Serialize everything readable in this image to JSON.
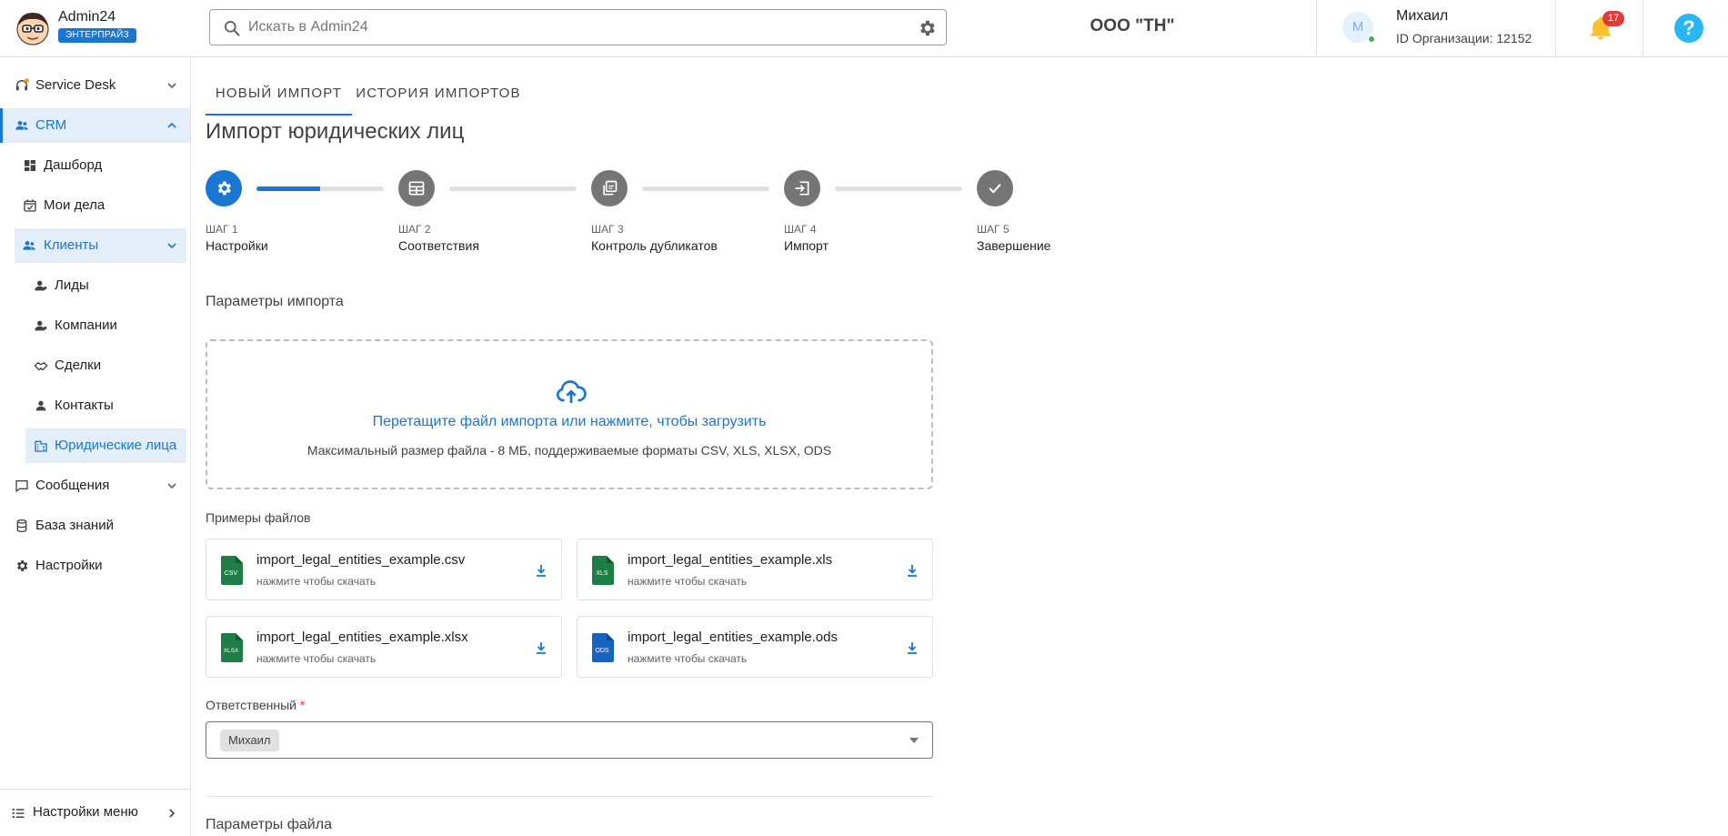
{
  "brand": {
    "name": "Admin24",
    "badge": "ЭНТЕРПРАЙЗ"
  },
  "search": {
    "placeholder": "Искать в Admin24"
  },
  "organization": {
    "name": "ООО \"ТН\""
  },
  "user": {
    "initial": "М",
    "name": "Михаил",
    "org_id": "ID Организации: 12152"
  },
  "notifications": {
    "count": "17"
  },
  "help": {
    "label": "?"
  },
  "sidebar": {
    "items": [
      {
        "label": "Service Desk"
      },
      {
        "label": "CRM"
      },
      {
        "label": "Дашборд"
      },
      {
        "label": "Мои дела"
      },
      {
        "label": "Клиенты"
      },
      {
        "label": "Лиды"
      },
      {
        "label": "Компании"
      },
      {
        "label": "Сделки"
      },
      {
        "label": "Контакты"
      },
      {
        "label": "Юридические лица"
      },
      {
        "label": "Сообщения"
      },
      {
        "label": "База знаний"
      },
      {
        "label": "Настройки"
      }
    ],
    "footer": {
      "label": "Настройки меню"
    }
  },
  "tabs": [
    {
      "label": "НОВЫЙ ИМПОРТ"
    },
    {
      "label": "ИСТОРИЯ ИМПОРТОВ"
    }
  ],
  "page": {
    "title": "Импорт юридических лиц"
  },
  "stepper": {
    "progress": 0.5,
    "steps": [
      {
        "num": "ШАГ 1",
        "label": "Настройки"
      },
      {
        "num": "ШАГ 2",
        "label": "Соответствия"
      },
      {
        "num": "ШАГ 3",
        "label": "Контроль дубликатов"
      },
      {
        "num": "ШАГ 4",
        "label": "Импорт"
      },
      {
        "num": "ШАГ 5",
        "label": "Завершение"
      }
    ]
  },
  "import_params": {
    "title": "Параметры импорта",
    "dropzone_title": "Перетащите файл импорта или нажмите, чтобы загрузить",
    "dropzone_hint": "Максимальный размер файла - 8 МБ, поддерживаемые форматы CSV, XLS, XLSX, ODS"
  },
  "examples": {
    "title": "Примеры файлов",
    "files": [
      {
        "name": "import_legal_entities_example.csv",
        "hint": "нажмите чтобы скачать",
        "ext": "CSV",
        "color": "#1e7e45"
      },
      {
        "name": "import_legal_entities_example.xls",
        "hint": "нажмите чтобы скачать",
        "ext": "XLS",
        "color": "#1e7e45"
      },
      {
        "name": "import_legal_entities_example.xlsx",
        "hint": "нажмите чтобы скачать",
        "ext": "XLSX",
        "color": "#1e7e45"
      },
      {
        "name": "import_legal_entities_example.ods",
        "hint": "нажмите чтобы скачать",
        "ext": "ODS",
        "color": "#1565c0"
      }
    ]
  },
  "responsible": {
    "label": "Ответственный",
    "required_mark": "*",
    "value": "Михаил"
  },
  "file_params": {
    "title": "Параметры файла"
  },
  "colors": {
    "accent": "#1976d2",
    "text": "#212121",
    "muted": "#757575",
    "border": "#e0e0e0"
  }
}
